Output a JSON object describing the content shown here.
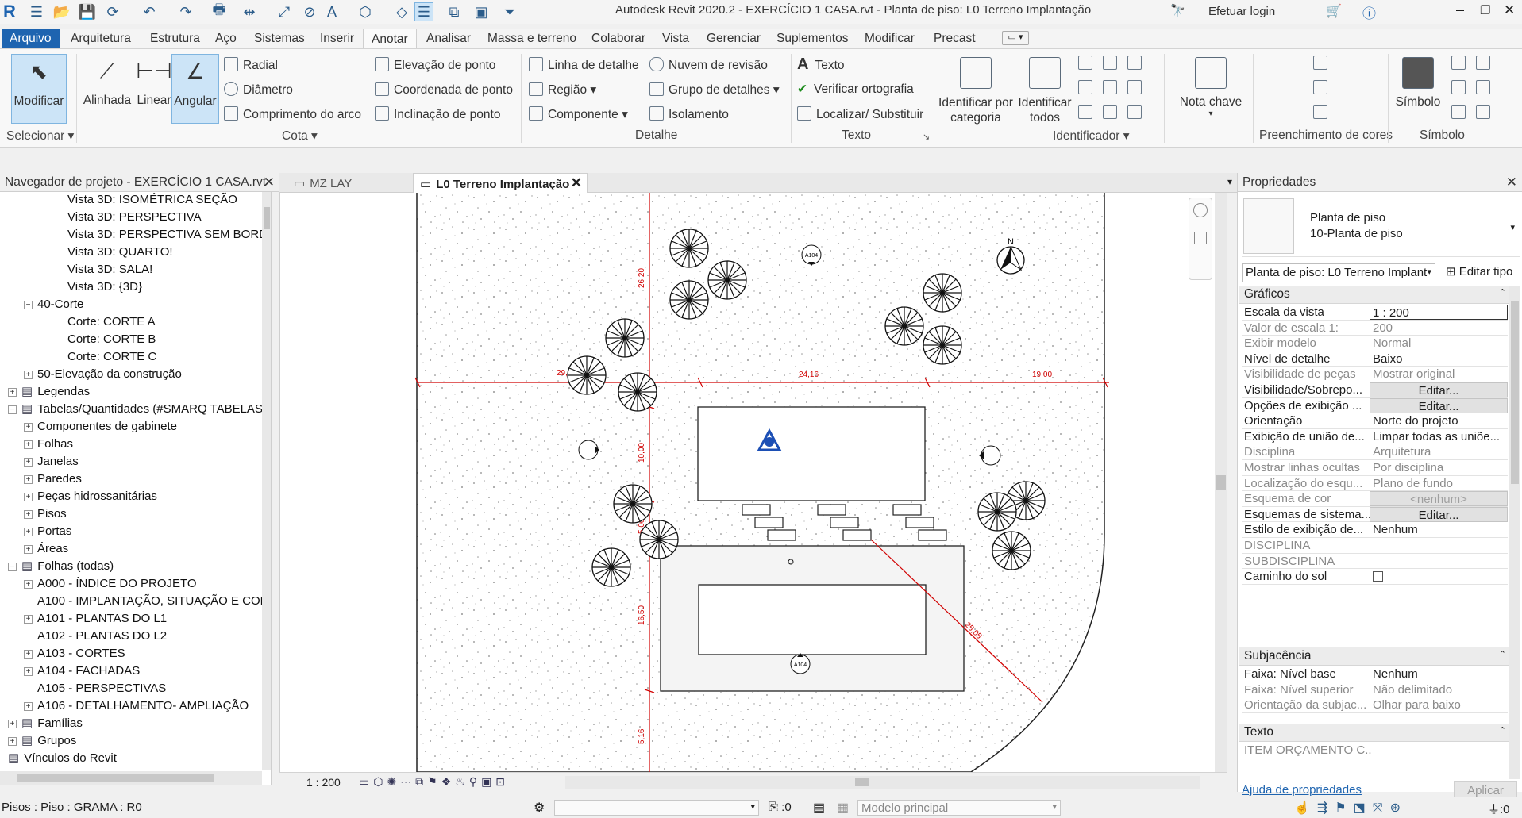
{
  "title": {
    "app": "Autodesk Revit 2020.2 - EXERCÍCIO 1 CASA.rvt - Planta de piso: L0 Terreno Implantação",
    "login": "Efetuar login"
  },
  "menu": [
    "Arquivo",
    "Arquitetura",
    "Estrutura",
    "Aço",
    "Sistemas",
    "Inserir",
    "Anotar",
    "Analisar",
    "Massa e terreno",
    "Colaborar",
    "Vista",
    "Gerenciar",
    "Suplementos",
    "Modificar",
    "Precast"
  ],
  "ribbon": {
    "modify": "Modificar",
    "select": "Selecionar",
    "dims": [
      "Alinhada",
      "Linear",
      "Angular"
    ],
    "cota_small": [
      "Radial",
      "Diâmetro",
      "Comprimento do arco",
      "Elevação de ponto",
      "Coordenada de ponto",
      "Inclinação de ponto"
    ],
    "cota": "Cota",
    "detalhe_items": [
      "Linha de detalhe",
      "Região",
      "Componente",
      "Nuvem de revisão",
      "Grupo de detalhes",
      "Isolamento"
    ],
    "detalhe": "Detalhe",
    "texto_items": [
      "Texto",
      "Verificar ortografia",
      "Localizar/ Substituir"
    ],
    "texto": "Texto",
    "ident_cat": "Identificar por categoria",
    "ident_all": "Identificar todos",
    "identificador": "Identificador",
    "nota": "Nota chave",
    "preenchimento": "Preenchimento de cores",
    "simbolo": "Símbolo",
    "simbolo_grp": "Símbolo"
  },
  "browser": {
    "header": "Navegador de projeto - EXERCÍCIO 1 CASA.rvt",
    "items": [
      {
        "label": "Vista 3D: ISOMÉTRICA SEÇÃO",
        "level": 3,
        "toggle": ""
      },
      {
        "label": "Vista 3D: PERSPECTIVA",
        "level": 3,
        "toggle": ""
      },
      {
        "label": "Vista 3D: PERSPECTIVA SEM BORDA",
        "level": 3,
        "toggle": ""
      },
      {
        "label": "Vista 3D: QUARTO!",
        "level": 3,
        "toggle": ""
      },
      {
        "label": "Vista 3D: SALA!",
        "level": 3,
        "toggle": ""
      },
      {
        "label": "Vista 3D: {3D}",
        "level": 3,
        "toggle": ""
      },
      {
        "label": "40-Corte",
        "level": 2,
        "toggle": "−"
      },
      {
        "label": "Corte: CORTE A",
        "level": 3,
        "toggle": ""
      },
      {
        "label": "Corte: CORTE B",
        "level": 3,
        "toggle": ""
      },
      {
        "label": "Corte: CORTE C",
        "level": 3,
        "toggle": ""
      },
      {
        "label": "50-Elevação da construção",
        "level": 2,
        "toggle": "+"
      },
      {
        "label": "Legendas",
        "level": 1,
        "toggle": "+"
      },
      {
        "label": "Tabelas/Quantidades (#SMARQ TABELAS",
        "level": 1,
        "toggle": "−"
      },
      {
        "label": "Componentes de gabinete",
        "level": 2,
        "toggle": "+"
      },
      {
        "label": "Folhas",
        "level": 2,
        "toggle": "+"
      },
      {
        "label": "Janelas",
        "level": 2,
        "toggle": "+"
      },
      {
        "label": "Paredes",
        "level": 2,
        "toggle": "+"
      },
      {
        "label": "Peças hidrossanitárias",
        "level": 2,
        "toggle": "+"
      },
      {
        "label": "Pisos",
        "level": 2,
        "toggle": "+"
      },
      {
        "label": "Portas",
        "level": 2,
        "toggle": "+"
      },
      {
        "label": "Áreas",
        "level": 2,
        "toggle": "+"
      },
      {
        "label": "Folhas (todas)",
        "level": 1,
        "toggle": "−"
      },
      {
        "label": "A000 - ÍNDICE DO PROJETO",
        "level": 2,
        "toggle": "+"
      },
      {
        "label": "A100 - IMPLANTAÇÃO, SITUAÇÃO E COB",
        "level": 2,
        "toggle": ""
      },
      {
        "label": "A101 - PLANTAS DO L1",
        "level": 2,
        "toggle": "+"
      },
      {
        "label": "A102 - PLANTAS DO L2",
        "level": 2,
        "toggle": ""
      },
      {
        "label": "A103 - CORTES",
        "level": 2,
        "toggle": "+"
      },
      {
        "label": "A104 - FACHADAS",
        "level": 2,
        "toggle": "+"
      },
      {
        "label": "A105 - PERSPECTIVAS",
        "level": 2,
        "toggle": ""
      },
      {
        "label": "A106 - DETALHAMENTO- AMPLIAÇÃO",
        "level": 2,
        "toggle": "+"
      },
      {
        "label": "Famílias",
        "level": 1,
        "toggle": "+"
      },
      {
        "label": "Grupos",
        "level": 1,
        "toggle": "+"
      },
      {
        "label": "Vínculos do Revit",
        "level": 1,
        "toggle": ""
      }
    ]
  },
  "tabs": {
    "inactive": "MZ LAY",
    "active": "L0 Terreno Implantação"
  },
  "view": {
    "scale": "1 : 200",
    "dims": [
      "26,20",
      "24,16",
      "19,00",
      "10,00",
      "5,00",
      "16,50",
      "5,16",
      "29,05",
      "25,05"
    ],
    "tags": [
      "A104",
      "A104"
    ],
    "north": "N"
  },
  "properties": {
    "header": "Propriedades",
    "type_line1": "Planta de piso",
    "type_line2": "10-Planta de piso",
    "selector": "Planta de piso: L0 Terreno Implant",
    "edit_type": "Editar tipo",
    "sections": {
      "graficos": "Gráficos",
      "subjacencia": "Subjacência",
      "texto": "Texto"
    },
    "rows": [
      {
        "k": "Escala da vista",
        "v": "1 : 200",
        "dis": false,
        "kind": "input"
      },
      {
        "k": "Valor de escala    1:",
        "v": "200",
        "dis": true,
        "kind": ""
      },
      {
        "k": "Exibir modelo",
        "v": "Normal",
        "dis": true,
        "kind": ""
      },
      {
        "k": "Nível de detalhe",
        "v": "Baixo",
        "dis": false,
        "kind": ""
      },
      {
        "k": "Visibilidade de peças",
        "v": "Mostrar original",
        "dis": true,
        "kind": ""
      },
      {
        "k": "Visibilidade/Sobrepo...",
        "v": "Editar...",
        "dis": false,
        "kind": "btn"
      },
      {
        "k": "Opções de exibição ...",
        "v": "Editar...",
        "dis": false,
        "kind": "btn"
      },
      {
        "k": "Orientação",
        "v": "Norte do projeto",
        "dis": false,
        "kind": ""
      },
      {
        "k": "Exibição de união de...",
        "v": "Limpar todas as uniõe...",
        "dis": false,
        "kind": ""
      },
      {
        "k": "Disciplina",
        "v": "Arquitetura",
        "dis": true,
        "kind": ""
      },
      {
        "k": "Mostrar linhas ocultas",
        "v": "Por disciplina",
        "dis": true,
        "kind": ""
      },
      {
        "k": "Localização do esqu...",
        "v": "Plano de fundo",
        "dis": true,
        "kind": ""
      },
      {
        "k": "Esquema de cor",
        "v": "<nenhum>",
        "dis": true,
        "kind": "btndis"
      },
      {
        "k": "Esquemas de sistema...",
        "v": "Editar...",
        "dis": false,
        "kind": "btn"
      },
      {
        "k": "Estilo de exibição de...",
        "v": "Nenhum",
        "dis": false,
        "kind": ""
      },
      {
        "k": "DISCIPLINA",
        "v": "",
        "dis": true,
        "kind": ""
      },
      {
        "k": "SUBDISCIPLINA",
        "v": "",
        "dis": true,
        "kind": ""
      },
      {
        "k": "Caminho do sol",
        "v": "",
        "dis": false,
        "kind": "check"
      }
    ],
    "rows2": [
      {
        "k": "Faixa: Nível base",
        "v": "Nenhum",
        "dis": false,
        "kind": ""
      },
      {
        "k": "Faixa: Nível superior",
        "v": "Não delimitado",
        "dis": true,
        "kind": ""
      },
      {
        "k": "Orientação da subjac...",
        "v": "Olhar para baixo",
        "dis": true,
        "kind": ""
      }
    ],
    "rows3": [
      {
        "k": "ITEM ORÇAMENTO C...",
        "v": "",
        "dis": true,
        "kind": ""
      }
    ],
    "help": "Ajuda de propriedades",
    "apply": "Aplicar"
  },
  "status": {
    "left": "Pisos : Piso : GRAMA : R0",
    "count": ":0",
    "model": "Modelo principal",
    "filter": ":0"
  },
  "colors": {
    "accent": "#1e64b0",
    "dim": "#d10000",
    "active": "#cce4f7"
  }
}
